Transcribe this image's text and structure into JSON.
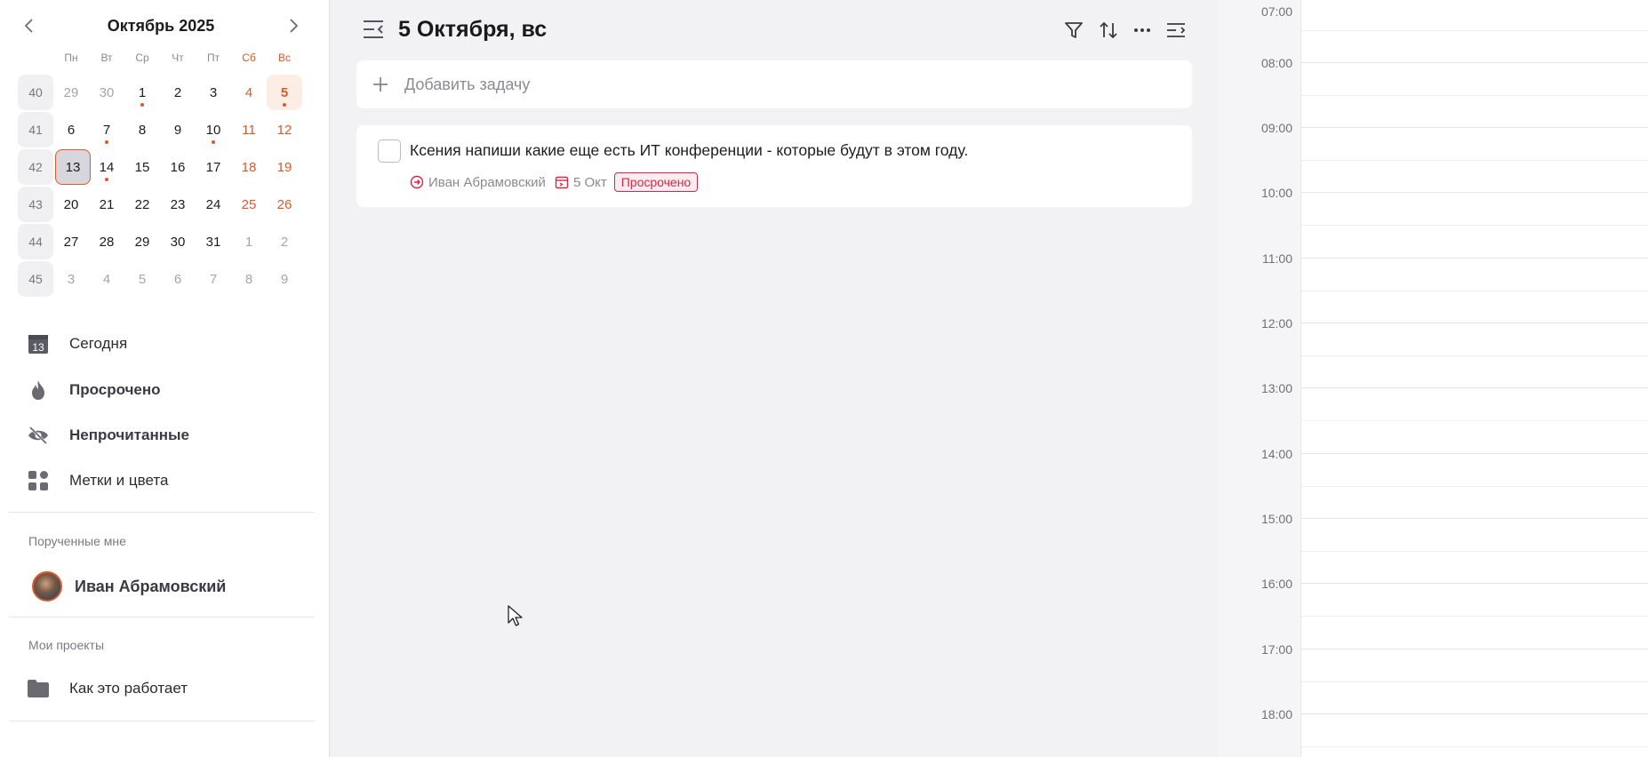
{
  "calendar": {
    "title": "Октябрь 2025",
    "weekdays": [
      "Пн",
      "Вт",
      "Ср",
      "Чт",
      "Пт",
      "Сб",
      "Вс"
    ],
    "weeks": [
      {
        "num": "40",
        "days": [
          "29",
          "30",
          "1",
          "2",
          "3",
          "4",
          "5"
        ]
      },
      {
        "num": "41",
        "days": [
          "6",
          "7",
          "8",
          "9",
          "10",
          "11",
          "12"
        ]
      },
      {
        "num": "42",
        "days": [
          "13",
          "14",
          "15",
          "16",
          "17",
          "18",
          "19"
        ]
      },
      {
        "num": "43",
        "days": [
          "20",
          "21",
          "22",
          "23",
          "24",
          "25",
          "26"
        ]
      },
      {
        "num": "44",
        "days": [
          "27",
          "28",
          "29",
          "30",
          "31",
          "1",
          "2"
        ]
      },
      {
        "num": "45",
        "days": [
          "3",
          "4",
          "5",
          "6",
          "7",
          "8",
          "9"
        ]
      }
    ],
    "selected_day": "5",
    "today": "13",
    "accent_color": "#e0572a"
  },
  "nav": {
    "today": "Сегодня",
    "today_icon_number": "13",
    "overdue": "Просрочено",
    "unread": "Непрочитанные",
    "labels": "Метки и цвета"
  },
  "sections": {
    "assigned_title": "Порученные мне",
    "assignee_name": "Иван Абрамовский",
    "projects_title": "Мои проекты",
    "project_name": "Как это работает"
  },
  "main": {
    "title": "5 Октября, вс",
    "add_task_placeholder": "Добавить задачу",
    "task": {
      "title": "Ксения напиши какие еще есть ИТ конференции - которые будут в этом году.",
      "assignee": "Иван Абрамовский",
      "date": "5 Окт",
      "status": "Просрочено",
      "status_color": "#d7264a"
    }
  },
  "timeline": {
    "hours": [
      "07:00",
      "08:00",
      "09:00",
      "10:00",
      "11:00",
      "12:00",
      "13:00",
      "14:00",
      "15:00",
      "16:00",
      "17:00",
      "18:00"
    ]
  }
}
